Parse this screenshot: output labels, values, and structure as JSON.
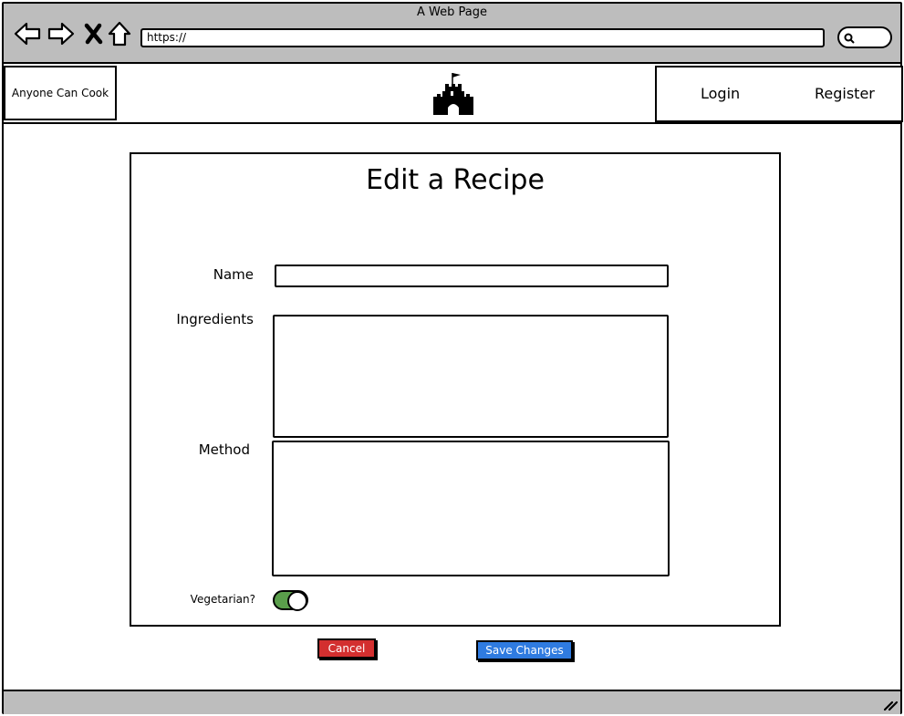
{
  "browser": {
    "title": "A Web Page",
    "url": "https://",
    "icons": [
      "back-arrow-icon",
      "forward-arrow-icon",
      "close-x-icon",
      "home-icon",
      "search-icon",
      "resize-grip-icon"
    ]
  },
  "header": {
    "brand": "Anyone Can Cook",
    "logo_icon": "castle-icon",
    "login_label": "Login",
    "register_label": "Register"
  },
  "form": {
    "title": "Edit a Recipe",
    "name_label": "Name",
    "name_value": "",
    "ingredients_label": "Ingredients",
    "ingredients_value": "",
    "method_label": "Method",
    "method_value": "",
    "vegetarian_label": "Vegetarian?",
    "vegetarian_on": true
  },
  "actions": {
    "cancel_label": "Cancel",
    "save_label": "Save Changes"
  },
  "colors": {
    "chrome": "#bdbdbd",
    "toggle_on": "#5a9e4b",
    "cancel": "#d32f2f",
    "save": "#2f7be0"
  }
}
